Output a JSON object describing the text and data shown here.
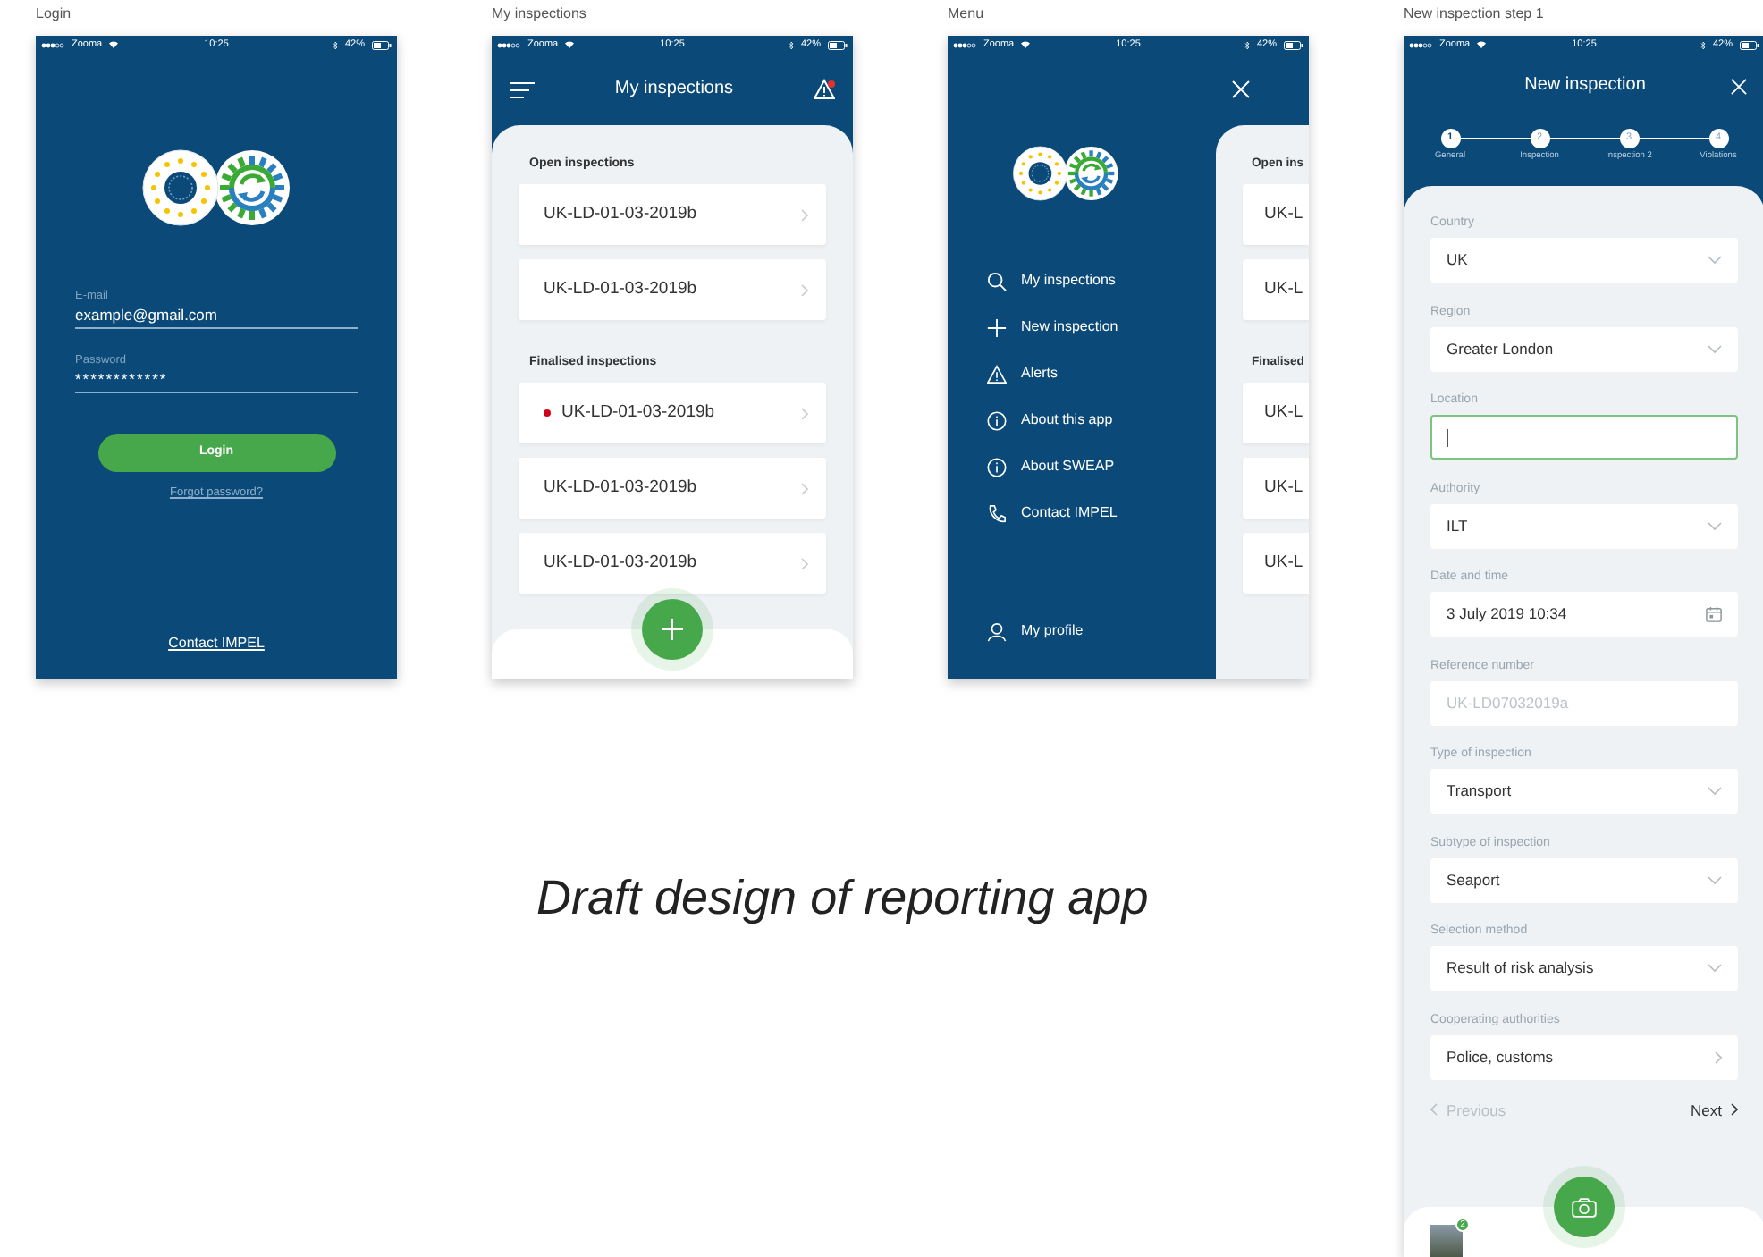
{
  "caption": "Draft design of reporting app",
  "screens": [
    {
      "kind": "login",
      "label": "Login",
      "status": {
        "carrier": "Zooma",
        "time": "10:25",
        "battery": "42%"
      },
      "email": {
        "label": "E-mail",
        "value": "example@gmail.com"
      },
      "password": {
        "label": "Password",
        "value": "************"
      },
      "login_button": "Login",
      "forgot_link": "Forgot password?",
      "contact_link": "Contact IMPEL"
    },
    {
      "kind": "list",
      "label": "My inspections",
      "status": {
        "carrier": "Zooma",
        "time": "10:25",
        "battery": "42%"
      },
      "title": "My inspections",
      "alert_dot": true,
      "sections": [
        {
          "heading": "Open inspections",
          "items": [
            {
              "text": "UK-LD-01-03-2019b",
              "flagged": false
            },
            {
              "text": "UK-LD-01-03-2019b",
              "flagged": false
            }
          ]
        },
        {
          "heading": "Finalised inspections",
          "items": [
            {
              "text": "UK-LD-01-03-2019b",
              "flagged": true
            },
            {
              "text": "UK-LD-01-03-2019b",
              "flagged": false
            },
            {
              "text": "UK-LD-01-03-2019b",
              "flagged": false
            }
          ]
        }
      ]
    },
    {
      "kind": "menu",
      "label": "Menu",
      "status": {
        "carrier": "Zooma",
        "time": "10:25",
        "battery": "42%"
      },
      "menu_items": [
        {
          "kind": "search",
          "text": "My inspections"
        },
        {
          "kind": "plus",
          "text": "New inspection"
        },
        {
          "kind": "warning",
          "text": "Alerts"
        },
        {
          "kind": "info",
          "text": "About this app"
        },
        {
          "kind": "info",
          "text": "About SWEAP"
        },
        {
          "kind": "phone",
          "text": "Contact IMPEL"
        }
      ],
      "profile": "My profile",
      "peek_sections": [
        {
          "heading": "Open ins",
          "items": [
            "UK-L",
            "UK-L"
          ]
        },
        {
          "heading": "Finalised",
          "items": [
            "UK-L",
            "UK-L",
            "UK-L"
          ]
        }
      ]
    },
    {
      "kind": "form",
      "label": "New inspection step 1",
      "status": {
        "carrier": "Zooma",
        "time": "10:25",
        "battery": "42%"
      },
      "title": "New inspection",
      "steps": [
        {
          "number": "1",
          "label": "General",
          "selected": true
        },
        {
          "number": "2",
          "label": "Inspection",
          "selected": false
        },
        {
          "number": "3",
          "label": "Inspection 2",
          "selected": false
        },
        {
          "number": "4",
          "label": "Violations",
          "selected": false
        }
      ],
      "fields": [
        {
          "kind": "select",
          "label": "Country",
          "value": "UK",
          "focused": false
        },
        {
          "kind": "select",
          "label": "Region",
          "value": "Greater London",
          "focused": false
        },
        {
          "kind": "text",
          "label": "Location",
          "focused": true
        },
        {
          "kind": "select",
          "label": "Authority",
          "value": "ILT",
          "focused": false
        },
        {
          "kind": "date",
          "label": "Date and time",
          "value": "3 July 2019 10:34",
          "focused": false
        },
        {
          "kind": "readonly",
          "label": "Reference number",
          "value": "UK-LD07032019a",
          "focused": false
        },
        {
          "kind": "select",
          "label": "Type of inspection",
          "value": "Transport",
          "focused": false
        },
        {
          "kind": "select",
          "label": "Subtype of inspection",
          "value": "Seaport",
          "focused": false
        },
        {
          "kind": "select",
          "label": "Selection method",
          "value": "Result of risk analysis",
          "focused": false
        },
        {
          "kind": "link",
          "label": "Cooperating authorities",
          "value": "Police, customs",
          "focused": false
        }
      ],
      "previous": {
        "text": "Previous",
        "disabled": true
      },
      "next": {
        "text": "Next",
        "disabled": false
      },
      "photo_count": "2"
    }
  ]
}
